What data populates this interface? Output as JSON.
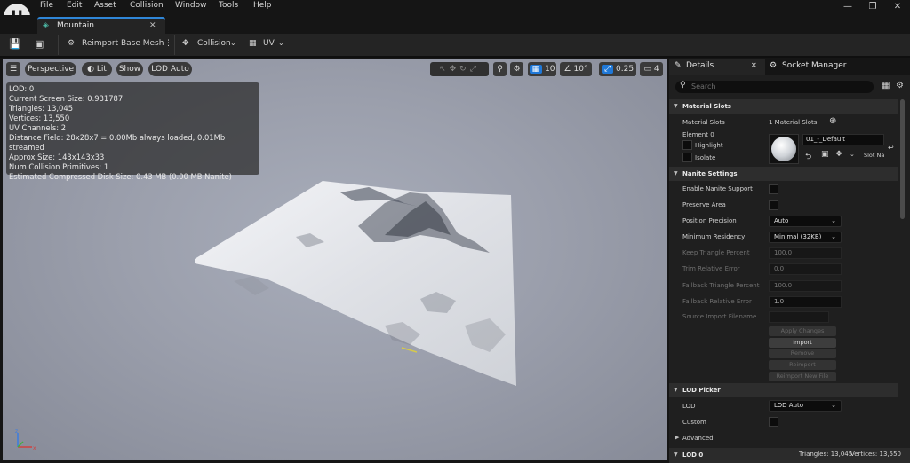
{
  "menu": [
    "File",
    "Edit",
    "Asset",
    "Collision",
    "Window",
    "Tools",
    "Help"
  ],
  "tab": {
    "title": "Mountain"
  },
  "toolbar": {
    "reimport": "Reimport Base Mesh",
    "collision": "Collision",
    "uv": "UV"
  },
  "viewport": {
    "perspective": "Perspective",
    "lit": "Lit",
    "show": "Show",
    "lod": "LOD Auto",
    "grid_snap": "10",
    "rot_snap": "10°",
    "scale_snap": "0.25",
    "camera_speed": "4"
  },
  "stats": [
    "LOD: 0",
    "Current Screen Size: 0.931787",
    "Triangles: 13,045",
    "Vertices: 13,550",
    "UV Channels: 2",
    "Distance Field: 28x28x7 = 0.00Mb always loaded, 0.01Mb streamed",
    "Approx Size: 143x143x33",
    "Num Collision Primitives: 1",
    "Estimated Compressed Disk Size: 0.43 MB (0.00 MB Nanite)"
  ],
  "panel": {
    "details_tab": "Details",
    "socket_tab": "Socket Manager",
    "search_placeholder": "Search",
    "material": {
      "header": "Material Slots",
      "slots_label": "Material Slots",
      "slots_value": "1 Material Slots",
      "element": "Element 0",
      "highlight": "Highlight",
      "isolate": "Isolate",
      "material_name": "01_-_Default",
      "slot_name": "Slot Na"
    },
    "nanite": {
      "header": "Nanite Settings",
      "enable": "Enable Nanite Support",
      "preserve": "Preserve Area",
      "position_precision": "Position Precision",
      "position_precision_value": "Auto",
      "min_residency": "Minimum Residency",
      "min_residency_value": "Minimal (32KB)",
      "keep_tri": "Keep Triangle Percent",
      "keep_tri_value": "100.0",
      "trim_err": "Trim Relative Error",
      "trim_err_value": "0.0",
      "fallback_tri": "Fallback Triangle Percent",
      "fallback_tri_value": "100.0",
      "fallback_err": "Fallback Relative Error",
      "fallback_err_value": "1.0",
      "source_import": "Source Import Filename",
      "source_import_more": "...",
      "apply": "Apply Changes",
      "import": "Import",
      "remove": "Remove",
      "reimport": "Reimport",
      "reimport_new": "Reimport New File"
    },
    "lod": {
      "header": "LOD Picker",
      "lod_label": "LOD",
      "lod_value": "LOD Auto",
      "custom": "Custom",
      "advanced": "Advanced",
      "lod0": "LOD 0",
      "tri": "Triangles: 13,045",
      "verts": "Vertices: 13,550"
    }
  }
}
